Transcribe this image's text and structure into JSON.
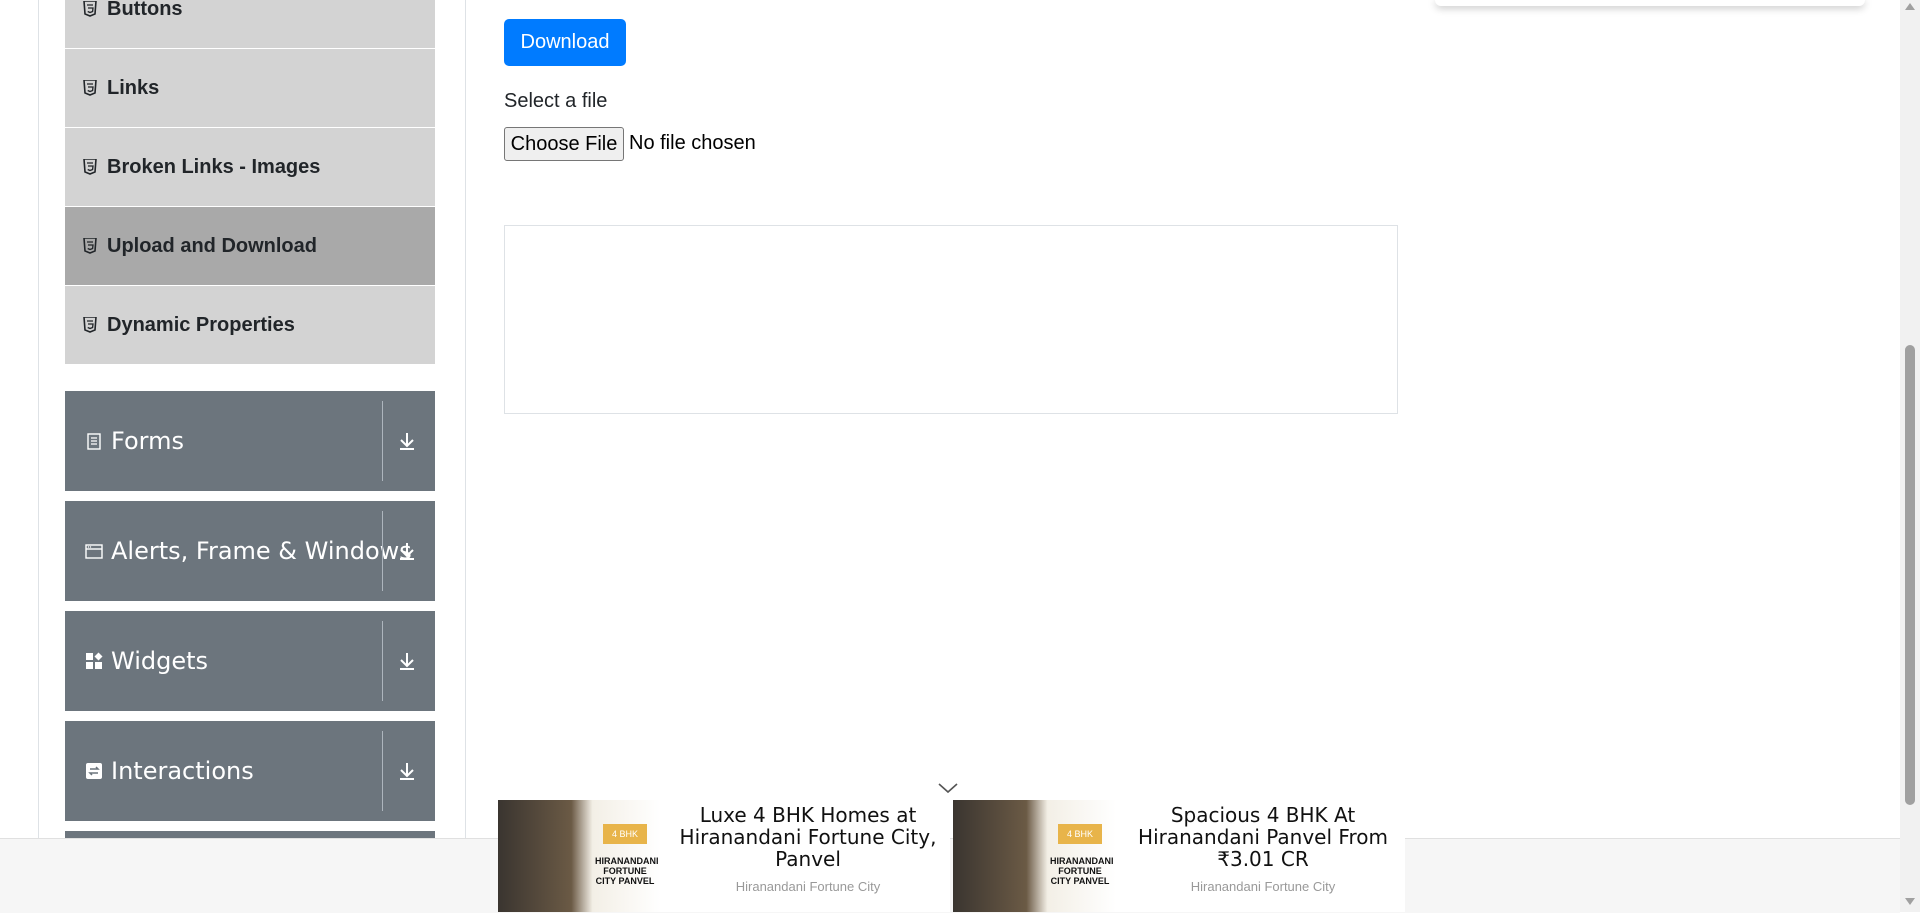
{
  "sidebar": {
    "items": [
      {
        "label": "Buttons",
        "active": false
      },
      {
        "label": "Links",
        "active": false
      },
      {
        "label": "Broken Links - Images",
        "active": false
      },
      {
        "label": "Upload and Download",
        "active": true
      },
      {
        "label": "Dynamic Properties",
        "active": false
      }
    ],
    "item_icon": "html5-icon",
    "groups": [
      {
        "title": "Forms",
        "icon": "form-icon",
        "toggle_icon": "download-arrow-icon"
      },
      {
        "title": "Alerts, Frame & Windows",
        "icon": "window-icon",
        "toggle_icon": "download-arrow-icon"
      },
      {
        "title": "Widgets",
        "icon": "widgets-icon",
        "toggle_icon": "download-arrow-icon"
      },
      {
        "title": "Interactions",
        "icon": "interactions-icon",
        "toggle_icon": "download-arrow-icon"
      }
    ]
  },
  "main": {
    "download_label": "Download",
    "select_label": "Select a file",
    "choose_file_label": "Choose File",
    "file_status": "No file chosen"
  },
  "ads": [
    {
      "title": "Luxe 4 BHK Homes at Hiranandani Fortune City, Panvel",
      "advertiser": "Hiranandani Fortune City",
      "image_text": "HIRANANDANI FORTUNE CITY PANVEL",
      "badge": "4 BHK"
    },
    {
      "title": "Spacious 4 BHK At Hiranandani Panvel From ₹3.01 CR",
      "advertiser": "Hiranandani Fortune City",
      "image_text": "HIRANANDANI FORTUNE CITY PANVEL",
      "badge": "4 BHK"
    }
  ],
  "colors": {
    "primary": "#007bff",
    "sidebar_item": "#d3d3d3",
    "sidebar_item_active": "#a9a9a9",
    "group_bg": "#6c757d"
  }
}
